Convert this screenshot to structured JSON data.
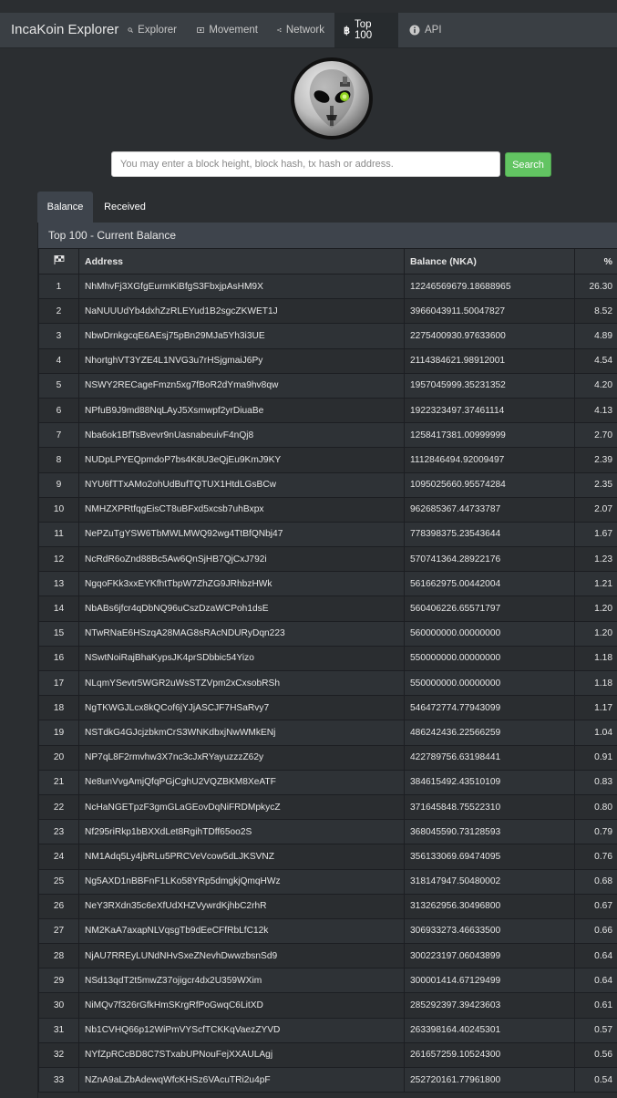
{
  "navbar": {
    "brand": "IncaKoin Explorer",
    "items": [
      {
        "label": "Explorer",
        "icon": "search-icon"
      },
      {
        "label": "Movement",
        "icon": "money-icon"
      },
      {
        "label": "Network",
        "icon": "share-icon"
      },
      {
        "label": "Top 100",
        "icon": "bitcoin-icon",
        "active": true
      },
      {
        "label": "API",
        "icon": "info-icon"
      }
    ]
  },
  "search": {
    "placeholder": "You may enter a block height, block hash, tx hash or address.",
    "button_label": "Search"
  },
  "tabs": {
    "balance": "Balance",
    "received": "Received"
  },
  "panel": {
    "title": "Top 100 - Current Balance",
    "columns": {
      "address": "Address",
      "balance": "Balance (NKA)",
      "percent": "%"
    }
  },
  "rows": [
    {
      "rank": "1",
      "address": "NhMhvFj3XGfgEurmKiBfgS3FbxjpAsHM9X",
      "balance": "12246569679.18688965",
      "percent": "26.30"
    },
    {
      "rank": "2",
      "address": "NaNUUUdYb4dxhZzRLEYud1B2sgcZKWET1J",
      "balance": "3966043911.50047827",
      "percent": "8.52"
    },
    {
      "rank": "3",
      "address": "NbwDrnkgcqE6AEsj75pBn29MJa5Yh3i3UE",
      "balance": "2275400930.97633600",
      "percent": "4.89"
    },
    {
      "rank": "4",
      "address": "NhortghVT3YZE4L1NVG3u7rHSjgmaiJ6Py",
      "balance": "2114384621.98912001",
      "percent": "4.54"
    },
    {
      "rank": "5",
      "address": "NSWY2RECageFmzn5xg7fBoR2dYma9hv8qw",
      "balance": "1957045999.35231352",
      "percent": "4.20"
    },
    {
      "rank": "6",
      "address": "NPfuB9J9md88NqLAyJ5Xsmwpf2yrDiuaBe",
      "balance": "1922323497.37461114",
      "percent": "4.13"
    },
    {
      "rank": "7",
      "address": "Nba6ok1BfTsBvevr9nUasnabeuivF4nQj8",
      "balance": "1258417381.00999999",
      "percent": "2.70"
    },
    {
      "rank": "8",
      "address": "NUDpLPYEQpmdoP7bs4K8U3eQjEu9KmJ9KY",
      "balance": "1112846494.92009497",
      "percent": "2.39"
    },
    {
      "rank": "9",
      "address": "NYU6fTTxAMo2ohUdBufTQTUX1HtdLGsBCw",
      "balance": "1095025660.95574284",
      "percent": "2.35"
    },
    {
      "rank": "10",
      "address": "NMHZXPRtfqgEisCT8uBFxd5xcsb7uhBxpx",
      "balance": "962685367.44733787",
      "percent": "2.07"
    },
    {
      "rank": "11",
      "address": "NePZuTgYSW6TbMWLMWQ92wg4TtBfQNbj47",
      "balance": "778398375.23543644",
      "percent": "1.67"
    },
    {
      "rank": "12",
      "address": "NcRdR6oZnd88Bc5Aw6QnSjHB7QjCxJ792i",
      "balance": "570741364.28922176",
      "percent": "1.23"
    },
    {
      "rank": "13",
      "address": "NgqoFKk3xxEYKfhtTbpW7ZhZG9JRhbzHWk",
      "balance": "561662975.00442004",
      "percent": "1.21"
    },
    {
      "rank": "14",
      "address": "NbABs6jfcr4qDbNQ96uCszDzaWCPoh1dsE",
      "balance": "560406226.65571797",
      "percent": "1.20"
    },
    {
      "rank": "15",
      "address": "NTwRNaE6HSzqA28MAG8sRAcNDURyDqn223",
      "balance": "560000000.00000000",
      "percent": "1.20"
    },
    {
      "rank": "16",
      "address": "NSwtNoiRajBhaKypsJK4prSDbbic54Yizo",
      "balance": "550000000.00000000",
      "percent": "1.18"
    },
    {
      "rank": "17",
      "address": "NLqmYSevtr5WGR2uWsSTZVpm2xCxsobRSh",
      "balance": "550000000.00000000",
      "percent": "1.18"
    },
    {
      "rank": "18",
      "address": "NgTKWGJLcx8kQCof6jYJjASCJF7HSaRvy7",
      "balance": "546472774.77943099",
      "percent": "1.17"
    },
    {
      "rank": "19",
      "address": "NSTdkG4GJcjzbkmCrS3WNKdbxjNwWMkENj",
      "balance": "486242436.22566259",
      "percent": "1.04"
    },
    {
      "rank": "20",
      "address": "NP7qL8F2rmvhw3X7nc3cJxRYayuzzzZ62y",
      "balance": "422789756.63198441",
      "percent": "0.91"
    },
    {
      "rank": "21",
      "address": "Ne8unVvgAmjQfqPGjCghU2VQZBKM8XeATF",
      "balance": "384615492.43510109",
      "percent": "0.83"
    },
    {
      "rank": "22",
      "address": "NcHaNGETpzF3gmGLaGEovDqNiFRDMpkycZ",
      "balance": "371645848.75522310",
      "percent": "0.80"
    },
    {
      "rank": "23",
      "address": "Nf295riRkp1bBXXdLet8RgihTDff65oo2S",
      "balance": "368045590.73128593",
      "percent": "0.79"
    },
    {
      "rank": "24",
      "address": "NM1Adq5Ly4jbRLu5PRCVeVcow5dLJKSVNZ",
      "balance": "356133069.69474095",
      "percent": "0.76"
    },
    {
      "rank": "25",
      "address": "Ng5AXD1nBBFnF1LKo58YRp5dmgkjQmqHWz",
      "balance": "318147947.50480002",
      "percent": "0.68"
    },
    {
      "rank": "26",
      "address": "NeY3RXdn35c6eXfUdXHZVywrdKjhbC2rhR",
      "balance": "313262956.30496800",
      "percent": "0.67"
    },
    {
      "rank": "27",
      "address": "NM2KaA7axapNLVqsgTb9dEeCFfRbLfC12k",
      "balance": "306933273.46633500",
      "percent": "0.66"
    },
    {
      "rank": "28",
      "address": "NjAU7RREyLUNdNHvSxeZNevhDwwzbsnSd9",
      "balance": "300223197.06043899",
      "percent": "0.64"
    },
    {
      "rank": "29",
      "address": "NSd13qdT2t5mwZ37ojigcr4dx2U359WXim",
      "balance": "300001414.67129499",
      "percent": "0.64"
    },
    {
      "rank": "30",
      "address": "NiMQv7f326rGfkHmSKrgRfPoGwqC6LitXD",
      "balance": "285292397.39423603",
      "percent": "0.61"
    },
    {
      "rank": "31",
      "address": "Nb1CVHQ66p12WiPmVYScfTCKKqVaezZYVD",
      "balance": "263398164.40245301",
      "percent": "0.57"
    },
    {
      "rank": "32",
      "address": "NYfZpRCcBD8C7STxabUPNouFejXXAULAgj",
      "balance": "261657259.10524300",
      "percent": "0.56"
    },
    {
      "rank": "33",
      "address": "NZnA9aLZbAdewqWfcKHSz6VAcuTRi2u4pF",
      "balance": "252720161.77961800",
      "percent": "0.54"
    }
  ]
}
